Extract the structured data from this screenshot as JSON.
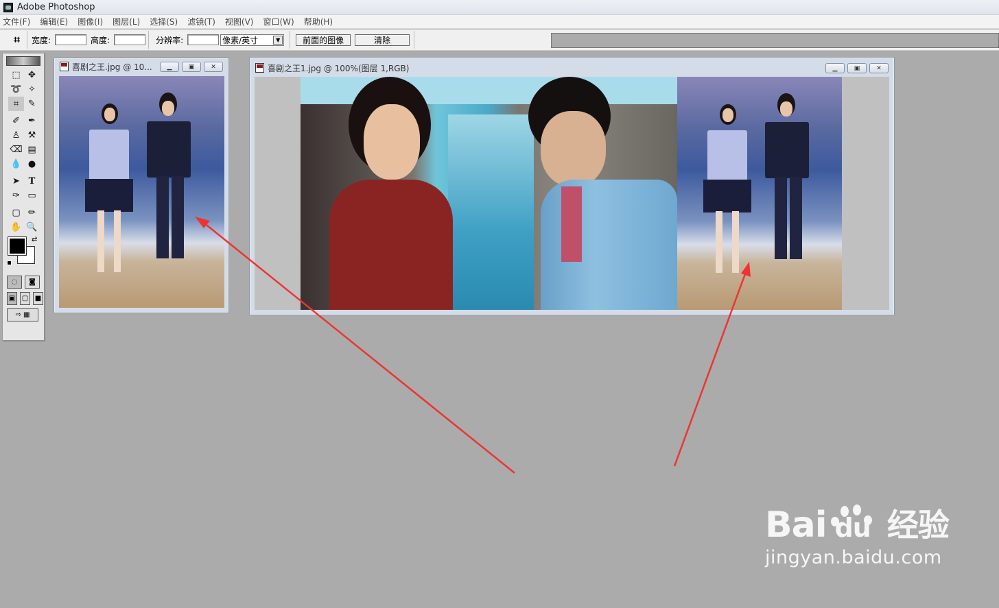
{
  "window": {
    "title": "Adobe Photoshop"
  },
  "menu": [
    "文件(F)",
    "编辑(E)",
    "图像(I)",
    "图层(L)",
    "选择(S)",
    "滤镜(T)",
    "视图(V)",
    "窗口(W)",
    "帮助(H)"
  ],
  "options": {
    "width_label": "宽度:",
    "height_label": "高度:",
    "resolution_label": "分辨率:",
    "unit_value": "像素/英寸",
    "front_image_button": "前面的图像",
    "clear_button": "清除"
  },
  "documents": [
    {
      "title": "喜剧之王.jpg @ 10..."
    },
    {
      "title": "喜剧之王1.jpg @ 100%(图层 1,RGB)"
    }
  ],
  "annotation": {
    "arrow_color": "#ee3333"
  },
  "watermark": {
    "brand": "Bai",
    "brand_suffix": "du",
    "cn": "经验",
    "url": "jingyan.baidu.com"
  },
  "colors": {
    "workspace": "#ababab",
    "foreground": "#000000",
    "background": "#ffffff"
  }
}
